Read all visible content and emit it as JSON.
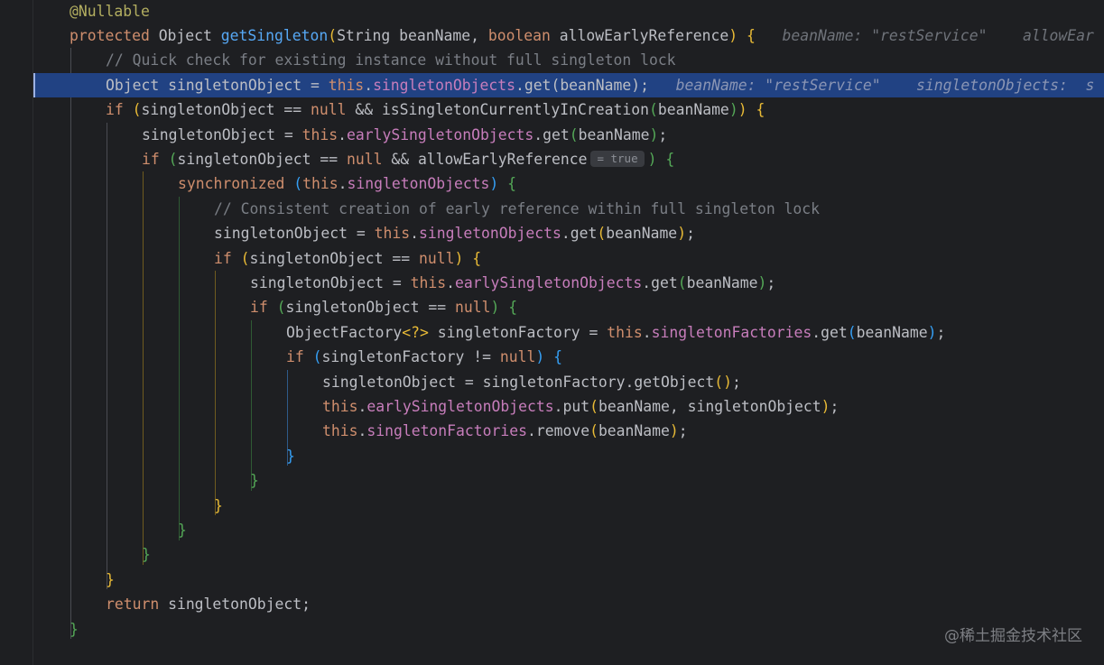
{
  "editor": {
    "lines": [
      {
        "indent": 0,
        "tokens": [
          {
            "t": "@Nullable",
            "c": "ann"
          }
        ]
      },
      {
        "indent": 0,
        "tokens": [
          {
            "t": "protected ",
            "c": "kw"
          },
          {
            "t": "Object "
          },
          {
            "t": "getSingleton",
            "c": "mth"
          },
          {
            "t": "(",
            "c": "p1"
          },
          {
            "t": "String beanName, "
          },
          {
            "t": "boolean ",
            "c": "kw"
          },
          {
            "t": "allowEarlyReference"
          },
          {
            "t": ")",
            "c": "p1"
          },
          {
            "t": " "
          },
          {
            "t": "{",
            "c": "p1"
          },
          {
            "t": "   beanName: \"restService\"    allowEar",
            "c": "hint"
          }
        ]
      },
      {
        "indent": 1,
        "tokens": [
          {
            "t": "// Quick check for existing instance without full singleton lock",
            "c": "cmt"
          }
        ]
      },
      {
        "indent": 1,
        "exec": true,
        "tokens": [
          {
            "t": "Object singletonObject = "
          },
          {
            "t": "this",
            "c": "kw"
          },
          {
            "t": "."
          },
          {
            "t": "singletonObjects",
            "c": "fld"
          },
          {
            "t": ".get"
          },
          {
            "t": "("
          },
          {
            "t": "beanName"
          },
          {
            "t": ")"
          },
          {
            "t": ";"
          },
          {
            "t": "   beanName: \"restService\"    singletonObjects:  s",
            "c": "hint"
          }
        ]
      },
      {
        "indent": 1,
        "tokens": [
          {
            "t": "if ",
            "c": "kw"
          },
          {
            "t": "(",
            "c": "p1"
          },
          {
            "t": "singletonObject == "
          },
          {
            "t": "null",
            "c": "kw"
          },
          {
            "t": " && isSingletonCurrentlyInCreation"
          },
          {
            "t": "(",
            "c": "p2"
          },
          {
            "t": "beanName"
          },
          {
            "t": ")",
            "c": "p2"
          },
          {
            "t": ")",
            "c": "p1"
          },
          {
            "t": " "
          },
          {
            "t": "{",
            "c": "p1"
          }
        ]
      },
      {
        "indent": 2,
        "tokens": [
          {
            "t": "singletonObject = "
          },
          {
            "t": "this",
            "c": "kw"
          },
          {
            "t": "."
          },
          {
            "t": "earlySingletonObjects",
            "c": "fld"
          },
          {
            "t": ".get"
          },
          {
            "t": "(",
            "c": "p2"
          },
          {
            "t": "beanName"
          },
          {
            "t": ")",
            "c": "p2"
          },
          {
            "t": ";"
          }
        ]
      },
      {
        "indent": 2,
        "tokens": [
          {
            "t": "if ",
            "c": "kw"
          },
          {
            "t": "(",
            "c": "p2"
          },
          {
            "t": "singletonObject == "
          },
          {
            "t": "null",
            "c": "kw"
          },
          {
            "t": " && allowEarlyReference"
          },
          {
            "t": "= true",
            "c": "inlay"
          },
          {
            "t": ")",
            "c": "p2"
          },
          {
            "t": " "
          },
          {
            "t": "{",
            "c": "p2"
          }
        ]
      },
      {
        "indent": 3,
        "tokens": [
          {
            "t": "synchronized ",
            "c": "kw"
          },
          {
            "t": "(",
            "c": "p3"
          },
          {
            "t": "this",
            "c": "kw"
          },
          {
            "t": "."
          },
          {
            "t": "singletonObjects",
            "c": "fld"
          },
          {
            "t": ")",
            "c": "p3"
          },
          {
            "t": " "
          },
          {
            "t": "{",
            "c": "p2"
          }
        ]
      },
      {
        "indent": 4,
        "tokens": [
          {
            "t": "// Consistent creation of early reference within full singleton lock",
            "c": "cmt"
          }
        ]
      },
      {
        "indent": 4,
        "tokens": [
          {
            "t": "singletonObject = "
          },
          {
            "t": "this",
            "c": "kw"
          },
          {
            "t": "."
          },
          {
            "t": "singletonObjects",
            "c": "fld"
          },
          {
            "t": ".get"
          },
          {
            "t": "(",
            "c": "p1"
          },
          {
            "t": "beanName"
          },
          {
            "t": ")",
            "c": "p1"
          },
          {
            "t": ";"
          }
        ]
      },
      {
        "indent": 4,
        "tokens": [
          {
            "t": "if ",
            "c": "kw"
          },
          {
            "t": "(",
            "c": "p1"
          },
          {
            "t": "singletonObject == "
          },
          {
            "t": "null",
            "c": "kw"
          },
          {
            "t": ")",
            "c": "p1"
          },
          {
            "t": " "
          },
          {
            "t": "{",
            "c": "p1"
          }
        ]
      },
      {
        "indent": 5,
        "tokens": [
          {
            "t": "singletonObject = "
          },
          {
            "t": "this",
            "c": "kw"
          },
          {
            "t": "."
          },
          {
            "t": "earlySingletonObjects",
            "c": "fld"
          },
          {
            "t": ".get"
          },
          {
            "t": "(",
            "c": "p2"
          },
          {
            "t": "beanName"
          },
          {
            "t": ")",
            "c": "p2"
          },
          {
            "t": ";"
          }
        ]
      },
      {
        "indent": 5,
        "tokens": [
          {
            "t": "if ",
            "c": "kw"
          },
          {
            "t": "(",
            "c": "p2"
          },
          {
            "t": "singletonObject == "
          },
          {
            "t": "null",
            "c": "kw"
          },
          {
            "t": ")",
            "c": "p2"
          },
          {
            "t": " "
          },
          {
            "t": "{",
            "c": "p2"
          }
        ]
      },
      {
        "indent": 6,
        "tokens": [
          {
            "t": "ObjectFactory"
          },
          {
            "t": "<?>",
            "c": "p1"
          },
          {
            "t": " singletonFactory = "
          },
          {
            "t": "this",
            "c": "kw"
          },
          {
            "t": "."
          },
          {
            "t": "singletonFactories",
            "c": "fld"
          },
          {
            "t": ".get"
          },
          {
            "t": "(",
            "c": "p3"
          },
          {
            "t": "beanName"
          },
          {
            "t": ")",
            "c": "p3"
          },
          {
            "t": ";"
          }
        ]
      },
      {
        "indent": 6,
        "tokens": [
          {
            "t": "if ",
            "c": "kw"
          },
          {
            "t": "(",
            "c": "p3"
          },
          {
            "t": "singletonFactory != "
          },
          {
            "t": "null",
            "c": "kw"
          },
          {
            "t": ")",
            "c": "p3"
          },
          {
            "t": " "
          },
          {
            "t": "{",
            "c": "p3"
          }
        ]
      },
      {
        "indent": 7,
        "tokens": [
          {
            "t": "singletonObject = singletonFactory.getObject"
          },
          {
            "t": "()",
            "c": "p1"
          },
          {
            "t": ";"
          }
        ]
      },
      {
        "indent": 7,
        "tokens": [
          {
            "t": "this",
            "c": "kw"
          },
          {
            "t": "."
          },
          {
            "t": "earlySingletonObjects",
            "c": "fld"
          },
          {
            "t": ".put"
          },
          {
            "t": "(",
            "c": "p1"
          },
          {
            "t": "beanName, singletonObject"
          },
          {
            "t": ")",
            "c": "p1"
          },
          {
            "t": ";"
          }
        ]
      },
      {
        "indent": 7,
        "tokens": [
          {
            "t": "this",
            "c": "kw"
          },
          {
            "t": "."
          },
          {
            "t": "singletonFactories",
            "c": "fld"
          },
          {
            "t": ".remove"
          },
          {
            "t": "(",
            "c": "p1"
          },
          {
            "t": "beanName"
          },
          {
            "t": ")",
            "c": "p1"
          },
          {
            "t": ";"
          }
        ]
      },
      {
        "indent": 6,
        "tokens": [
          {
            "t": "}",
            "c": "p3"
          }
        ]
      },
      {
        "indent": 5,
        "tokens": [
          {
            "t": "}",
            "c": "p2"
          }
        ]
      },
      {
        "indent": 4,
        "tokens": [
          {
            "t": "}",
            "c": "p1"
          }
        ]
      },
      {
        "indent": 3,
        "tokens": [
          {
            "t": "}",
            "c": "p2"
          }
        ]
      },
      {
        "indent": 2,
        "tokens": [
          {
            "t": "}",
            "c": "p2"
          }
        ]
      },
      {
        "indent": 1,
        "tokens": [
          {
            "t": "}",
            "c": "p1"
          }
        ]
      },
      {
        "indent": 1,
        "tokens": [
          {
            "t": "return ",
            "c": "kw"
          },
          {
            "t": "singletonObject;"
          }
        ]
      },
      {
        "indent": 0,
        "tokens": [
          {
            "t": "}",
            "c": "p2"
          }
        ]
      }
    ]
  },
  "watermark": "@稀土掘金技术社区",
  "colors": {
    "background": "#1e1f22",
    "execution_line": "#214283",
    "keyword": "#cf8e6d",
    "field": "#c77dbb",
    "method": "#56a8f5",
    "annotation": "#b3ae60",
    "comment": "#7a7e85"
  }
}
